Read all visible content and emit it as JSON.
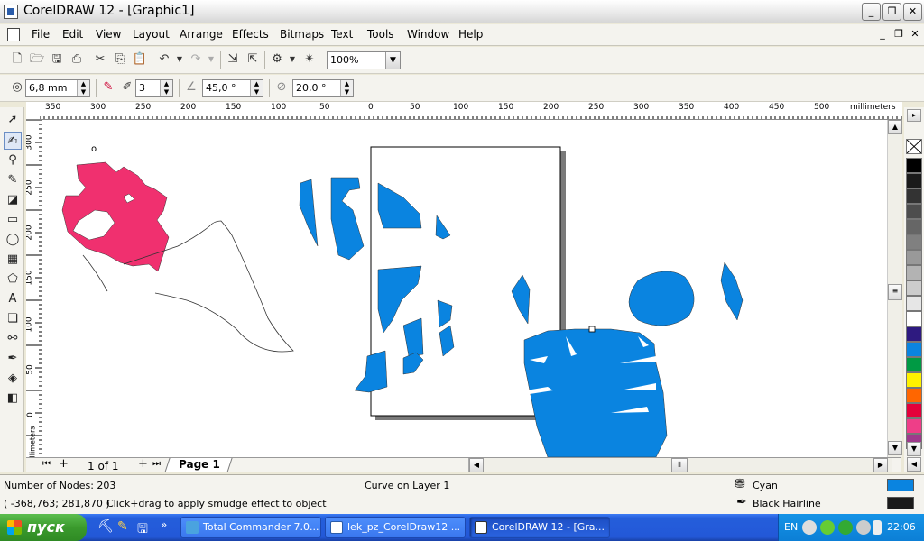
{
  "window": {
    "title": "CorelDRAW 12 - [Graphic1]",
    "minimize_label": "_",
    "restore_label": "❐",
    "close_label": "✕"
  },
  "menubar": {
    "items": [
      "File",
      "Edit",
      "View",
      "Layout",
      "Arrange",
      "Effects",
      "Bitmaps",
      "Text",
      "Tools",
      "Window",
      "Help"
    ]
  },
  "standard_toolbar": {
    "zoom_value": "100%"
  },
  "property_bar": {
    "nib_size": "6,8 mm",
    "pressure": "3",
    "angle": "45,0 °",
    "fixation": "20,0 °"
  },
  "rulers": {
    "horizontal_ticks": [
      "350",
      "300",
      "250",
      "200",
      "150",
      "100",
      "50",
      "0",
      "50",
      "100",
      "150",
      "200",
      "250",
      "300",
      "350",
      "400",
      "450",
      "500"
    ],
    "horizontal_unit": "millimeters",
    "vertical_ticks": [
      "300",
      "250",
      "200",
      "150",
      "100",
      "50",
      "0"
    ],
    "vertical_unit": "millimeters"
  },
  "page_nav": {
    "page_count": "1 of 1",
    "page_tab": "Page 1"
  },
  "canvas": {
    "node_marker": "o",
    "colors": {
      "blue": "#0a84e0",
      "pink": "#f0306f",
      "page_border": "#000000",
      "page_shadow": "#7a7a7a"
    }
  },
  "palette": {
    "swatches": [
      "#000000",
      "#1a1a1a",
      "#333333",
      "#4d4d4d",
      "#666666",
      "#808080",
      "#999999",
      "#b3b3b3",
      "#cccccc",
      "#e6e6e6",
      "#ffffff",
      "#2e1a80",
      "#0a84e0",
      "#009a44",
      "#fff200",
      "#ff6600",
      "#e4003a",
      "#ee3e88",
      "#9e3a8c"
    ]
  },
  "statusbar": {
    "nodes": "Number of Nodes: 203",
    "object_info": "Curve on Layer 1",
    "coordinates": "( -368,763; 281,870 )",
    "hint": "Click+drag to apply smudge effect to object",
    "fill_label": "Cyan",
    "fill_color": "#0a84e0",
    "outline_label": "Black  Hairline",
    "outline_color": "#1a1a1a"
  },
  "taskbar": {
    "start_label": "пуск",
    "tasks": [
      {
        "label": "Total Commander 7.0...",
        "active": false
      },
      {
        "label": "lek_pz_CorelDraw12 ...",
        "active": false
      },
      {
        "label": "CorelDRAW 12 - [Gra...",
        "active": true
      }
    ],
    "language": "EN",
    "clock": "22:06"
  }
}
